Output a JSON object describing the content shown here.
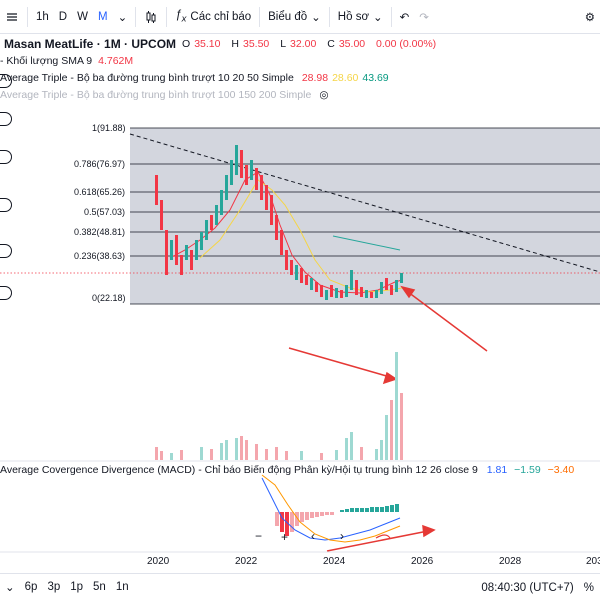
{
  "toolbar": {
    "intervals": [
      "1h",
      "D",
      "W",
      "M"
    ],
    "active_interval": "M",
    "indicators_label": "Các chỉ báo",
    "chart_type_label": "Biểu đồ",
    "profile_label": "Hồ sơ"
  },
  "symbol": {
    "name": "Masan MeatLife · 1M · UPCOM",
    "open_label": "O",
    "open": "35.10",
    "high_label": "H",
    "high": "35.50",
    "low_label": "L",
    "low": "32.00",
    "close_label": "C",
    "close": "35.00",
    "change": "0.00 (0.00%)"
  },
  "indicators": {
    "volume": {
      "label": "- Khối lượng SMA 9",
      "value": "4.762M"
    },
    "ma1": {
      "label": "Average Triple - Bộ ba đường trung bình trượt 10 20 50 Simple",
      "v1": "28.98",
      "v2": "28.60",
      "v3": "43.69"
    },
    "ma2": {
      "label": "Average Triple - Bộ ba đường trung bình trượt 100 150 200 Simple"
    },
    "macd": {
      "label": "Average Covergence Divergence (MACD) - Chỉ báo Biến động Phân kỳ/Hội tụ trung bình 12 26 close 9",
      "v1": "1.81",
      "v2": "−1.59",
      "v3": "−3.40"
    }
  },
  "fib_levels": [
    {
      "label": "1(91.88)"
    },
    {
      "label": "0.786(76.97)"
    },
    {
      "label": "0.618(65.26)"
    },
    {
      "label": "0.5(57.03)"
    },
    {
      "label": "0.382(48.81)"
    },
    {
      "label": "0.236(38.63)"
    },
    {
      "label": "0(22.18)"
    }
  ],
  "x_axis": [
    "2020",
    "2022",
    "2024",
    "2026",
    "2028",
    "203"
  ],
  "bottom": {
    "ranges": [
      "6p",
      "3p",
      "1p",
      "5n",
      "1n"
    ],
    "time": "08:40:30 (UTC+7)"
  },
  "colors": {
    "up": "#26a69a",
    "down": "#f23645",
    "accent": "#2962ff",
    "fib_fill": "#d1d4dc",
    "annotation_red": "#e53935"
  }
}
